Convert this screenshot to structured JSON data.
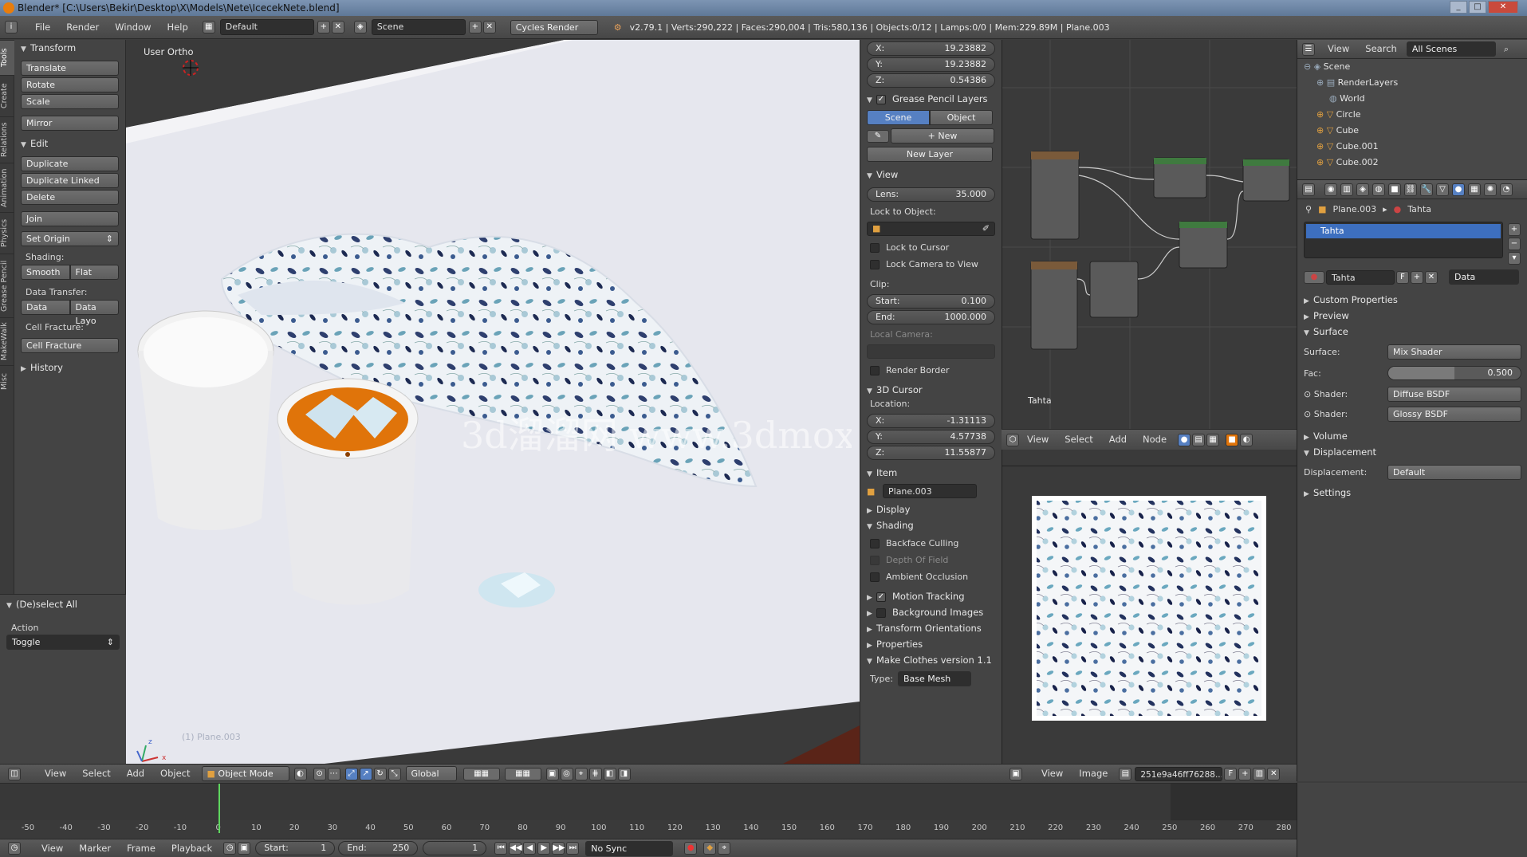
{
  "window": {
    "title": "Blender* [C:\\Users\\Bekir\\Desktop\\X\\Models\\Nete\\IcecekNete.blend]",
    "minimize": "_",
    "maximize": "□",
    "close": "✕"
  },
  "info": {
    "menus": [
      "File",
      "Render",
      "Window",
      "Help"
    ],
    "layout": "Default",
    "scene": "Scene",
    "engine": "Cycles Render",
    "stats": "v2.79.1 | Verts:290,222 | Faces:290,004 | Tris:580,136 | Objects:0/12 | Lamps:0/0 | Mem:229.89M | Plane.003"
  },
  "vtabs": [
    "Tools",
    "Create",
    "Relations",
    "Animation",
    "Physics",
    "Grease Pencil",
    "MakeWalk",
    "Misc"
  ],
  "toolshelf": {
    "transform_title": "Transform",
    "translate": "Translate",
    "rotate": "Rotate",
    "scale": "Scale",
    "mirror": "Mirror",
    "edit_title": "Edit",
    "duplicate": "Duplicate",
    "duplicate_linked": "Duplicate Linked",
    "delete": "Delete",
    "join": "Join",
    "set_origin": "Set Origin",
    "shading_label": "Shading:",
    "smooth": "Smooth",
    "flat": "Flat",
    "data_transfer_label": "Data Transfer:",
    "data": "Data",
    "data_layo": "Data Layo",
    "cell_fracture_label": "Cell Fracture:",
    "cell_fracture": "Cell Fracture",
    "history": "History"
  },
  "operator": {
    "title": "(De)select All",
    "action_label": "Action",
    "action_value": "Toggle"
  },
  "viewport": {
    "view_name": "User Ortho",
    "object_label": "(1) Plane.003",
    "watermark": "3d溜溜网 www.3dmox.com",
    "axis_x": "x",
    "axis_z": "z"
  },
  "npanel": {
    "x": "X:",
    "x_val": "19.23882",
    "y": "Y:",
    "y_val": "19.23882",
    "z": "Z:",
    "z_val": "0.54386",
    "gp_layers": "Grease Pencil Layers",
    "scene_tab": "Scene",
    "object_tab": "Object",
    "new": "New",
    "new_layer": "New Layer",
    "view_title": "View",
    "lens": "Lens:",
    "lens_val": "35.000",
    "lock_to_object": "Lock to Object:",
    "lock_to_cursor": "Lock to Cursor",
    "lock_camera": "Lock Camera to View",
    "clip": "Clip:",
    "start": "Start:",
    "start_val": "0.100",
    "end": "End:",
    "end_val": "1000.000",
    "local_camera": "Local Camera:",
    "render_border": "Render Border",
    "cursor_title": "3D Cursor",
    "location": "Location:",
    "cx_val": "-1.31113",
    "cy_val": "4.57738",
    "cz_val": "11.55877",
    "item_title": "Item",
    "item_name": "Plane.003",
    "display": "Display",
    "shading": "Shading",
    "backface": "Backface Culling",
    "dof": "Depth Of Field",
    "ao": "Ambient Occlusion",
    "motion": "Motion Tracking",
    "bg_images": "Background Images",
    "transform_orient": "Transform Orientations",
    "properties": "Properties",
    "make_clothes": "Make Clothes version 1.1",
    "type": "Type:",
    "type_val": "Base Mesh"
  },
  "nodeeditor": {
    "material_label": "Tahta",
    "menus": [
      "View",
      "Select",
      "Add",
      "Node"
    ]
  },
  "imageeditor": {
    "menus": [
      "View",
      "Image"
    ],
    "image_name": "251e9a46ff76288...",
    "fake": "F"
  },
  "outliner": {
    "menus": [
      "View",
      "Search"
    ],
    "scope": "All Scenes",
    "items": [
      "Scene",
      "RenderLayers",
      "World",
      "Circle",
      "Cube",
      "Cube.001",
      "Cube.002"
    ]
  },
  "props": {
    "breadcrumb_obj": "Plane.003",
    "breadcrumb_mat": "Tahta",
    "slot": "Tahta",
    "material": "Tahta",
    "fake": "F",
    "link": "Data",
    "custom_props": "Custom Properties",
    "preview": "Preview",
    "surface_title": "Surface",
    "surface_label": "Surface:",
    "surface_val": "Mix Shader",
    "fac_label": "Fac:",
    "fac_val": "0.500",
    "fac_fraction": 0.5,
    "shader_label": "Shader:",
    "shader1": "Diffuse BSDF",
    "shader2": "Glossy BSDF",
    "volume": "Volume",
    "displacement_title": "Displacement",
    "displacement_label": "Displacement:",
    "displacement_val": "Default",
    "settings": "Settings"
  },
  "viewbar": {
    "menus": [
      "View",
      "Select",
      "Add",
      "Object"
    ],
    "mode": "Object Mode",
    "orientation": "Global"
  },
  "timeline": {
    "ticks": [
      "-50",
      "-40",
      "-30",
      "-20",
      "-10",
      "0",
      "10",
      "20",
      "30",
      "40",
      "50",
      "60",
      "70",
      "80",
      "90",
      "100",
      "110",
      "120",
      "130",
      "140",
      "150",
      "160",
      "170",
      "180",
      "190",
      "200",
      "210",
      "220",
      "230",
      "240",
      "250",
      "260",
      "270",
      "280"
    ],
    "current_frame": 0,
    "menus": [
      "View",
      "Marker",
      "Frame",
      "Playback"
    ],
    "start_label": "Start:",
    "start_val": "1",
    "end_label": "End:",
    "end_val": "250",
    "frame_val": "1",
    "sync": "No Sync"
  },
  "colors": {
    "accent_blue": "#5680c2",
    "orange": "#e0740a",
    "active_blue": "#3d6fbf"
  }
}
